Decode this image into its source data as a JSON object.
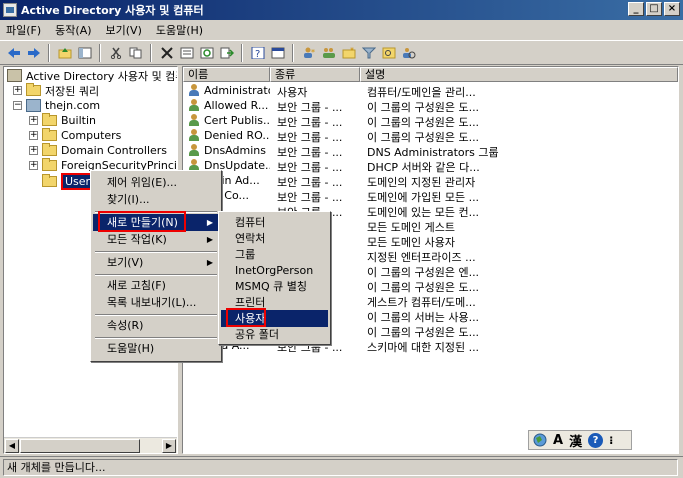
{
  "window": {
    "title": "Active Directory 사용자 및 컴퓨터",
    "min": "_",
    "max": "□",
    "close": "×"
  },
  "menubar": [
    "파일(F)",
    "동작(A)",
    "보기(V)",
    "도움말(H)"
  ],
  "toolbar_icons": [
    "back-icon",
    "forward-icon",
    "up-icon",
    "show-tree-icon",
    "cut-icon",
    "copy-icon",
    "delete-icon",
    "properties-icon",
    "refresh-icon",
    "export-icon",
    "help-icon",
    "console-icon",
    "new-user-icon",
    "new-group-icon",
    "new-ou-icon",
    "filter-icon",
    "find-icon",
    "add-to-group-icon"
  ],
  "tree": {
    "root": "Active Directory 사용자 및 컴퓨터",
    "saved_queries": "저장된 쿼리",
    "domain": "thejn.com",
    "children": [
      "Builtin",
      "Computers",
      "Domain Controllers",
      "ForeignSecurityPrincipals"
    ],
    "selected": "Users"
  },
  "list": {
    "columns": [
      "이름",
      "종류",
      "설명"
    ],
    "rows": [
      {
        "name": "Administrator",
        "type": "사용자",
        "desc": "컴퓨터/도메인을 관리..."
      },
      {
        "name": "Allowed R...",
        "type": "보안 그룹 - ...",
        "desc": "이 그룹의 구성원은 도..."
      },
      {
        "name": "Cert Publis...",
        "type": "보안 그룹 - ...",
        "desc": "이 그룹의 구성원은 도..."
      },
      {
        "name": "Denied RO...",
        "type": "보안 그룹 - ...",
        "desc": "이 그룹의 구성원은 도..."
      },
      {
        "name": "DnsAdmins",
        "type": "보안 그룹 - ...",
        "desc": "DNS Administrators 그룹"
      },
      {
        "name": "DnsUpdate...",
        "type": "보안 그룹 - ...",
        "desc": "DHCP 서버와 같은 다..."
      },
      {
        "name": "main Ad...",
        "type": "보안 그룹 - ...",
        "desc": "도메인의 지정된 관리자"
      },
      {
        "name": "ain Co...",
        "type": "보안 그룹 - ...",
        "desc": "도메인에 가입된 모든 ..."
      },
      {
        "name": "",
        "type": "보안 그룹 - ...",
        "desc": "도메인에 있는 모든 컨..."
      },
      {
        "name": "",
        "type": "",
        "desc": "모든 도메인 게스트"
      },
      {
        "name": "",
        "type": "",
        "desc": "모든 도메인 사용자"
      },
      {
        "name": "",
        "type": "",
        "desc": "지정된 엔터프라이즈 ..."
      },
      {
        "name": "",
        "type": "",
        "desc": "이 그룹의 구성원은 엔..."
      },
      {
        "name": "",
        "type": "",
        "desc": "이 그룹의 구성원은 도..."
      },
      {
        "name": "",
        "type": "",
        "desc": "게스트가 컴퓨터/도메..."
      },
      {
        "name": "",
        "type": "",
        "desc": "이 그룹의 서버는 사용..."
      },
      {
        "name": "",
        "type": "",
        "desc": "이 그룹의 구성원은 도..."
      },
      {
        "name": "ema A...",
        "type": "보안 그룹 - ...",
        "desc": "스키마에 대한 지정된 ..."
      }
    ]
  },
  "context_menu": {
    "items": [
      "제어 위임(E)...",
      "찾기(I)...",
      "새로 만들기(N)",
      "모든 작업(K)",
      "보기(V)",
      "새로 고침(F)",
      "목록 내보내기(L)...",
      "속성(R)",
      "도움말(H)"
    ]
  },
  "submenu": {
    "items": [
      "컴퓨터",
      "연락처",
      "그룹",
      "InetOrgPerson",
      "MSMQ 큐 별칭",
      "프린터",
      "사용자",
      "공유 폴더"
    ]
  },
  "langbar": {
    "a": "A",
    "han": "漢",
    "help": "?",
    "more": "⁝"
  },
  "status": "새 개체를 만듭니다..."
}
